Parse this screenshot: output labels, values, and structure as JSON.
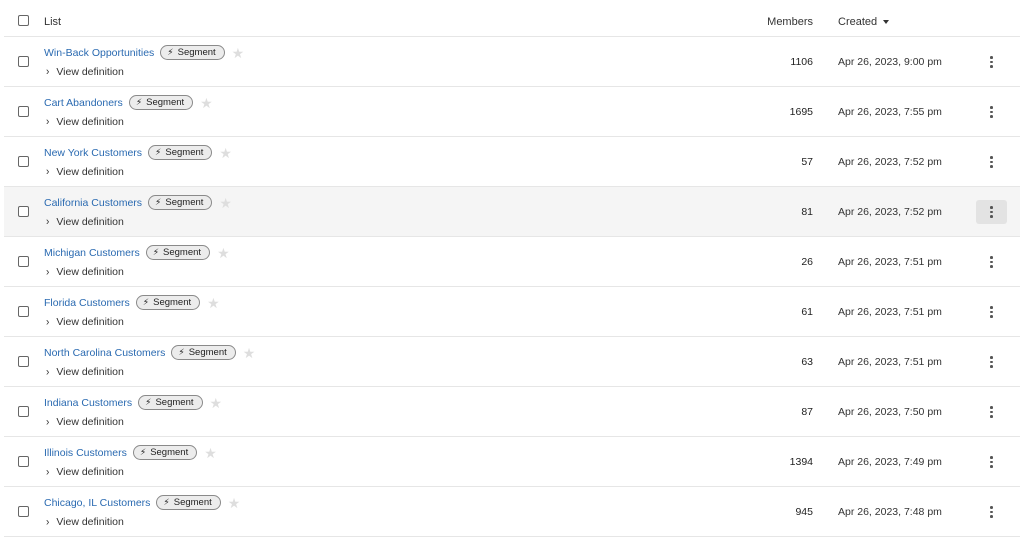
{
  "header": {
    "list_label": "List",
    "members_label": "Members",
    "created_label": "Created"
  },
  "badge_label": "Segment",
  "definition_label": "View definition",
  "rows": [
    {
      "name": "Win-Back Opportunities",
      "members": "1106",
      "created": "Apr 26, 2023, 9:00 pm"
    },
    {
      "name": "Cart Abandoners",
      "members": "1695",
      "created": "Apr 26, 2023, 7:55 pm"
    },
    {
      "name": "New York Customers",
      "members": "57",
      "created": "Apr 26, 2023, 7:52 pm"
    },
    {
      "name": "California Customers",
      "members": "81",
      "created": "Apr 26, 2023, 7:52 pm"
    },
    {
      "name": "Michigan Customers",
      "members": "26",
      "created": "Apr 26, 2023, 7:51 pm"
    },
    {
      "name": "Florida Customers",
      "members": "61",
      "created": "Apr 26, 2023, 7:51 pm"
    },
    {
      "name": "North Carolina Customers",
      "members": "63",
      "created": "Apr 26, 2023, 7:51 pm"
    },
    {
      "name": "Indiana Customers",
      "members": "87",
      "created": "Apr 26, 2023, 7:50 pm"
    },
    {
      "name": "Illinois Customers",
      "members": "1394",
      "created": "Apr 26, 2023, 7:49 pm"
    },
    {
      "name": "Chicago, IL Customers",
      "members": "945",
      "created": "Apr 26, 2023, 7:48 pm"
    }
  ],
  "colors": {
    "link": "#2a6ab1",
    "hover_row": "#f5f5f5",
    "divider": "#e6e6e6"
  },
  "icons": {
    "badge": "lightning-bolt-icon",
    "favorite": "star-icon",
    "expand": "chevron-right-icon",
    "menu": "kebab-menu-icon",
    "sort": "caret-down-icon"
  }
}
